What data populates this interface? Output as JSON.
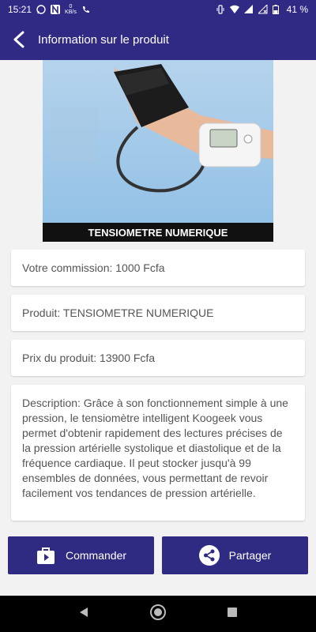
{
  "status_bar": {
    "time": "15:21",
    "kbs_value": "0",
    "kbs_unit": "KB/s",
    "battery": "41 %"
  },
  "app_bar": {
    "title": "Information sur le produit",
    "back_icon": "arrow-back-icon"
  },
  "product": {
    "image_caption": "TENSIOMETRE NUMERIQUE",
    "commission": "Votre commission: 1000 Fcfa",
    "name": "Produit: TENSIOMETRE NUMERIQUE",
    "price": "Prix du produit: 13900 Fcfa",
    "description": "Description: Grâce à son fonctionnement simple à une pression, le tensiomètre intelligent Koogeek vous permet d'obtenir rapidement des lectures précises de la pression artérielle systolique et diastolique et de la fréquence cardiaque. Il peut stocker jusqu'à 99 ensembles de données, vous permettant de revoir facilement vos tendances de pression artérielle."
  },
  "actions": {
    "order_label": "Commander",
    "share_label": "Partager"
  },
  "colors": {
    "primary": "#312a85",
    "button": "#2f2a82"
  }
}
